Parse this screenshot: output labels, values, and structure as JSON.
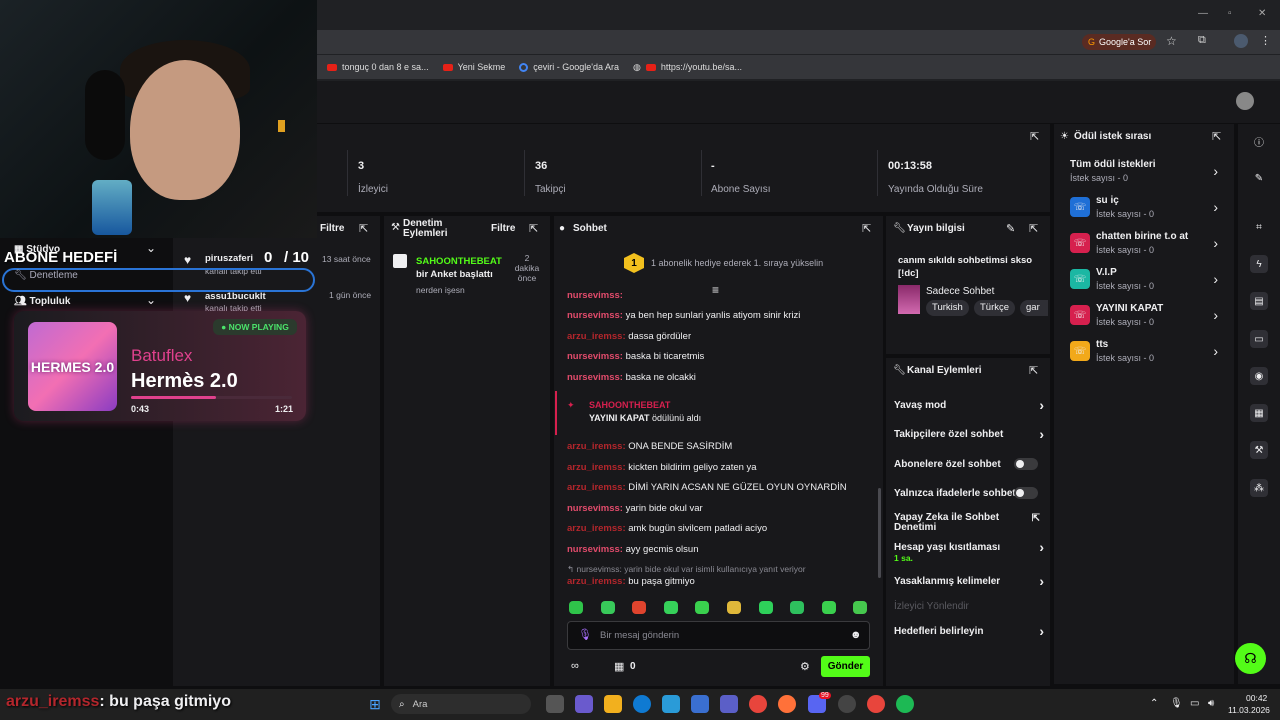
{
  "browser": {
    "bookmarks": [
      "tonguç 0 dan 8 e sa...",
      "Yeni Sekme",
      "çeviri - Google'da Ara",
      "https://youtu.be/sa..."
    ],
    "google_button": "Google'a Sor"
  },
  "stats": [
    {
      "value": "3",
      "label": "İzleyici"
    },
    {
      "value": "36",
      "label": "Takipçi"
    },
    {
      "value": "-",
      "label": "Abone Sayısı"
    },
    {
      "value": "00:13:58",
      "label": "Yayında Olduğu Süre"
    }
  ],
  "overlay": {
    "abone_hedefi": "ABONE HEDEFİ",
    "studyo": "Stüdyo",
    "denetleme": "Denetleme",
    "topluluk": "Topluluk",
    "goal_current": "0",
    "goal_target": "/ 10"
  },
  "activity": {
    "filter": "Filtre",
    "items": [
      {
        "user": "piruszaferi",
        "text": "kanalı takip etti",
        "time": "13 saat önce"
      },
      {
        "user": "assu1bucuklt",
        "text": "kanalı takip etti",
        "time": "1 gün önce"
      }
    ]
  },
  "now_playing": {
    "badge": "● NOW PLAYING",
    "artist": "Batuflex",
    "title": "Hermès 2.0",
    "cover_text": "HERMES 2.0",
    "elapsed": "0:43",
    "duration": "1:21",
    "progress": 0.53
  },
  "moderation": {
    "title": "Denetim Eylemleri",
    "filter": "Filtre",
    "item": {
      "user": "SAHOONTHEBEAT",
      "action": "bir Anket başlattı",
      "detail": "nerden işesn",
      "time": "2 dakika önce"
    }
  },
  "chat": {
    "title": "Sohbet",
    "promo_rank": "1",
    "promo_text": "1 abonelik hediye ederek 1. sıraya yükselin",
    "partial_user": "nursevimss:",
    "messages": [
      {
        "user": "nursevimss:",
        "text": "ya ben hep sunlari yanlis atiyom sinir krizi",
        "color": "pink"
      },
      {
        "user": "arzu_iremss:",
        "text": "dassa gördüler",
        "color": "red"
      },
      {
        "user": "nursevimss:",
        "text": "baska bi ticaretmis",
        "color": "pink"
      },
      {
        "user": "nursevimss:",
        "text": "baska ne olcakki",
        "color": "pink"
      }
    ],
    "redeem": {
      "user": "SAHOONTHEBEAT",
      "reward": "YAYINI KAPAT",
      "suffix": "ödülünü aldı"
    },
    "messages2": [
      {
        "user": "arzu_iremss:",
        "text": "ONA BENDE SASİRDİM",
        "color": "red"
      },
      {
        "user": "arzu_iremss:",
        "text": "kickten bildirim geliyo zaten ya",
        "color": "red"
      },
      {
        "user": "arzu_iremss:",
        "text": "DİMİ YARIN ACSAN NE GÜZEL OYUN OYNARDİN",
        "color": "red"
      },
      {
        "user": "nursevimss:",
        "text": "yarin bide okul var",
        "color": "pink"
      },
      {
        "user": "arzu_iremss:",
        "text": "amk bugün sivilcem patladi aciyo",
        "color": "red"
      },
      {
        "user": "nursevimss:",
        "text": "ayy gecmis olsun",
        "color": "pink"
      }
    ],
    "reply_ref": "↰ nursevimss: yarin bide okul var isimli kullanıcıya yanıt veriyor",
    "reply": {
      "user": "arzu_iremss:",
      "text": "bu paşa gitmiyo"
    },
    "input_placeholder": "Bir mesaj gönderin",
    "points": "0",
    "send": "Gönder",
    "emote_colors": [
      "#2fc44a",
      "#38c95a",
      "#e0442e",
      "#36d15a",
      "#3ad04e",
      "#e0b83a",
      "#2ed05a",
      "#2ec05e",
      "#3ad04e",
      "#46c84e"
    ]
  },
  "stream_info": {
    "title": "Yayın bilgisi",
    "stream_title": "canım sıkıldı sohbetimsi skso [!dc]",
    "category": "Sadece Sohbet",
    "tags": [
      "Turkish",
      "Türkçe",
      "gar"
    ]
  },
  "channel_actions": {
    "title": "Kanal Eylemleri",
    "items": [
      {
        "label": "Yavaş mod",
        "kind": "chevron"
      },
      {
        "label": "Takipçilere özel sohbet",
        "kind": "chevron"
      },
      {
        "label": "Abonelere özel sohbet",
        "kind": "toggle"
      },
      {
        "label": "Yalnızca ifadelerle sohbet",
        "kind": "toggle"
      },
      {
        "label": "Yapay Zeka ile Sohbet Denetimi",
        "kind": "external"
      },
      {
        "label": "Hesap yaşı kısıtlaması",
        "kind": "chevron",
        "sub": "1 sa."
      },
      {
        "label": "Yasaklanmış kelimeler",
        "kind": "chevron"
      },
      {
        "label": "İzleyici Yönlendir",
        "kind": "disabled"
      },
      {
        "label": "Hedefleri belirleyin",
        "kind": "chevron"
      }
    ]
  },
  "rewards": {
    "title": "Ödül istek sırası",
    "all": {
      "name": "Tüm ödül istekleri",
      "count": "İstek sayısı - 0"
    },
    "items": [
      {
        "name": "su iç",
        "count": "İstek sayısı - 0",
        "color": "#1f6fd6"
      },
      {
        "name": "chatten birine t.o at",
        "count": "İstek sayısı - 0",
        "color": "#d6204e"
      },
      {
        "name": "V.I.P",
        "count": "İstek sayısı - 0",
        "color": "#1bb7a3"
      },
      {
        "name": "YAYINI KAPAT",
        "count": "İstek sayısı - 0",
        "color": "#d6204e"
      },
      {
        "name": "tts",
        "count": "İstek sayısı - 0",
        "color": "#f2a91a"
      }
    ]
  },
  "bottom_overlay": {
    "user": "arzu_iremss",
    "separator": ":",
    "text": "bu paşa gitmiyo"
  },
  "taskbar": {
    "search": "Ara",
    "time": "00:42",
    "date": "11.03.2026",
    "badge": "99"
  }
}
